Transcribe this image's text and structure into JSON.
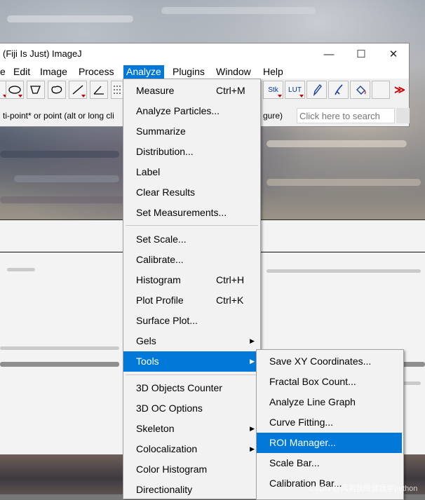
{
  "window": {
    "title": "(Fiji Is Just) ImageJ",
    "controls": {
      "minimize": "—",
      "maximize": "☐",
      "close": "✕"
    }
  },
  "menubar": [
    "e",
    "Edit",
    "Image",
    "Process",
    "Analyze",
    "Plugins",
    "Window",
    "Help"
  ],
  "toolbar": {
    "stk_label": "Stk",
    "lut_label": "LUT",
    "more_label": "≫"
  },
  "status": {
    "text": "ti-point* or point (alt or long cli",
    "text_right": "gure)",
    "search_placeholder": "Click here to search"
  },
  "analyze_menu": {
    "items": [
      {
        "label": "Measure",
        "shortcut": "Ctrl+M"
      },
      {
        "label": "Analyze Particles...",
        "shortcut": ""
      },
      {
        "label": "Summarize",
        "shortcut": ""
      },
      {
        "label": "Distribution...",
        "shortcut": ""
      },
      {
        "label": "Label",
        "shortcut": ""
      },
      {
        "label": "Clear Results",
        "shortcut": ""
      },
      {
        "label": "Set Measurements...",
        "shortcut": ""
      },
      {
        "label": "Set Scale...",
        "shortcut": ""
      },
      {
        "label": "Calibrate...",
        "shortcut": ""
      },
      {
        "label": "Histogram",
        "shortcut": "Ctrl+H"
      },
      {
        "label": "Plot Profile",
        "shortcut": "Ctrl+K"
      },
      {
        "label": "Surface Plot...",
        "shortcut": ""
      },
      {
        "label": "Gels",
        "shortcut": ""
      },
      {
        "label": "Tools",
        "shortcut": ""
      },
      {
        "label": "3D Objects Counter",
        "shortcut": ""
      },
      {
        "label": "3D OC Options",
        "shortcut": ""
      },
      {
        "label": "Skeleton",
        "shortcut": ""
      },
      {
        "label": "Colocalization",
        "shortcut": ""
      },
      {
        "label": "Color Histogram",
        "shortcut": ""
      },
      {
        "label": "Directionality",
        "shortcut": ""
      }
    ]
  },
  "tools_submenu": {
    "items": [
      "Save XY Coordinates...",
      "Fractal Box Count...",
      "Analyze Line Graph",
      "Curve Fitting...",
      "ROI Manager...",
      "Scale Bar...",
      "Calibration Bar..."
    ]
  },
  "watermark": "CSDN @风到我嗯健我学python",
  "colors": {
    "highlight": "#0078d7",
    "menu_bg": "#f2f2f2"
  }
}
